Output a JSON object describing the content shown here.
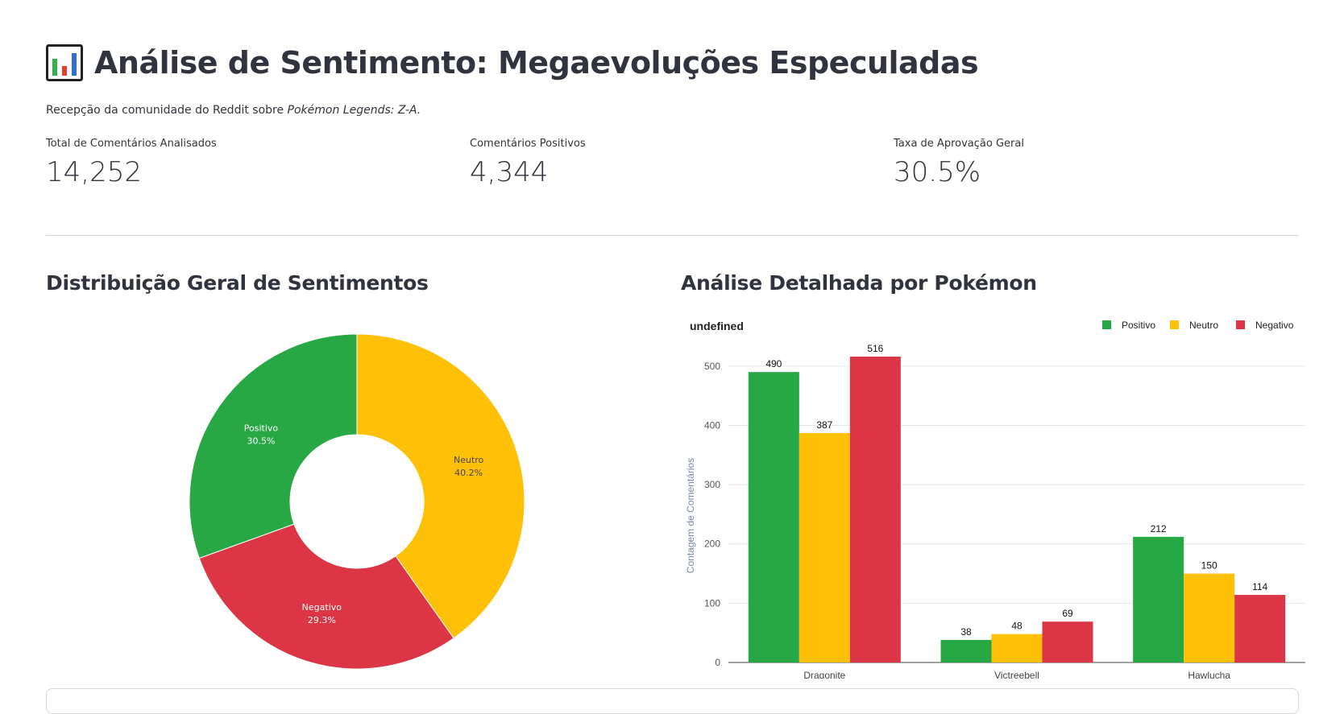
{
  "header": {
    "title": "Análise de Sentimento: Megaevoluções Especuladas",
    "title_icon": "bar-chart-emoji-icon",
    "subtitle_prefix": "Recepção da comunidade do Reddit sobre ",
    "subtitle_emphasis": "Pokémon Legends: Z-A."
  },
  "metrics": [
    {
      "label": "Total de Comentários Analisados",
      "value": "14,252"
    },
    {
      "label": "Comentários Positivos",
      "value": "4,344"
    },
    {
      "label": "Taxa de Aprovação Geral",
      "value": "30.5%"
    }
  ],
  "sections": {
    "left_title": "Distribuição Geral de Sentimentos",
    "right_title": "Análise Detalhada por Pokémon"
  },
  "colors": {
    "positive": "#28a745",
    "neutral": "#ffc107",
    "negative": "#dc3545",
    "text": "#31333f"
  },
  "chart_data": [
    {
      "type": "pie",
      "donut": true,
      "slices": [
        {
          "label": "Neutro",
          "value": 40.2,
          "text": "40.2%",
          "color": "#ffc107"
        },
        {
          "label": "Negativo",
          "value": 29.3,
          "text": "29.3%",
          "color": "#dc3545"
        },
        {
          "label": "Positivo",
          "value": 30.5,
          "text": "30.5%",
          "color": "#28a745"
        }
      ]
    },
    {
      "type": "bar",
      "title": "undefined",
      "categories": [
        "Dragonite",
        "Victreebell",
        "Hawlucha"
      ],
      "series": [
        {
          "name": "Positivo",
          "color": "#28a745",
          "values": [
            490,
            38,
            212
          ]
        },
        {
          "name": "Neutro",
          "color": "#ffc107",
          "values": [
            387,
            48,
            150
          ]
        },
        {
          "name": "Negativo",
          "color": "#dc3545",
          "values": [
            516,
            69,
            114
          ]
        }
      ],
      "ylabel": "Contagem de Comentários",
      "ylim": [
        0,
        550
      ],
      "yticks": [
        0,
        100,
        200,
        300,
        400,
        500
      ],
      "grid": true,
      "legend": "top-right"
    }
  ]
}
